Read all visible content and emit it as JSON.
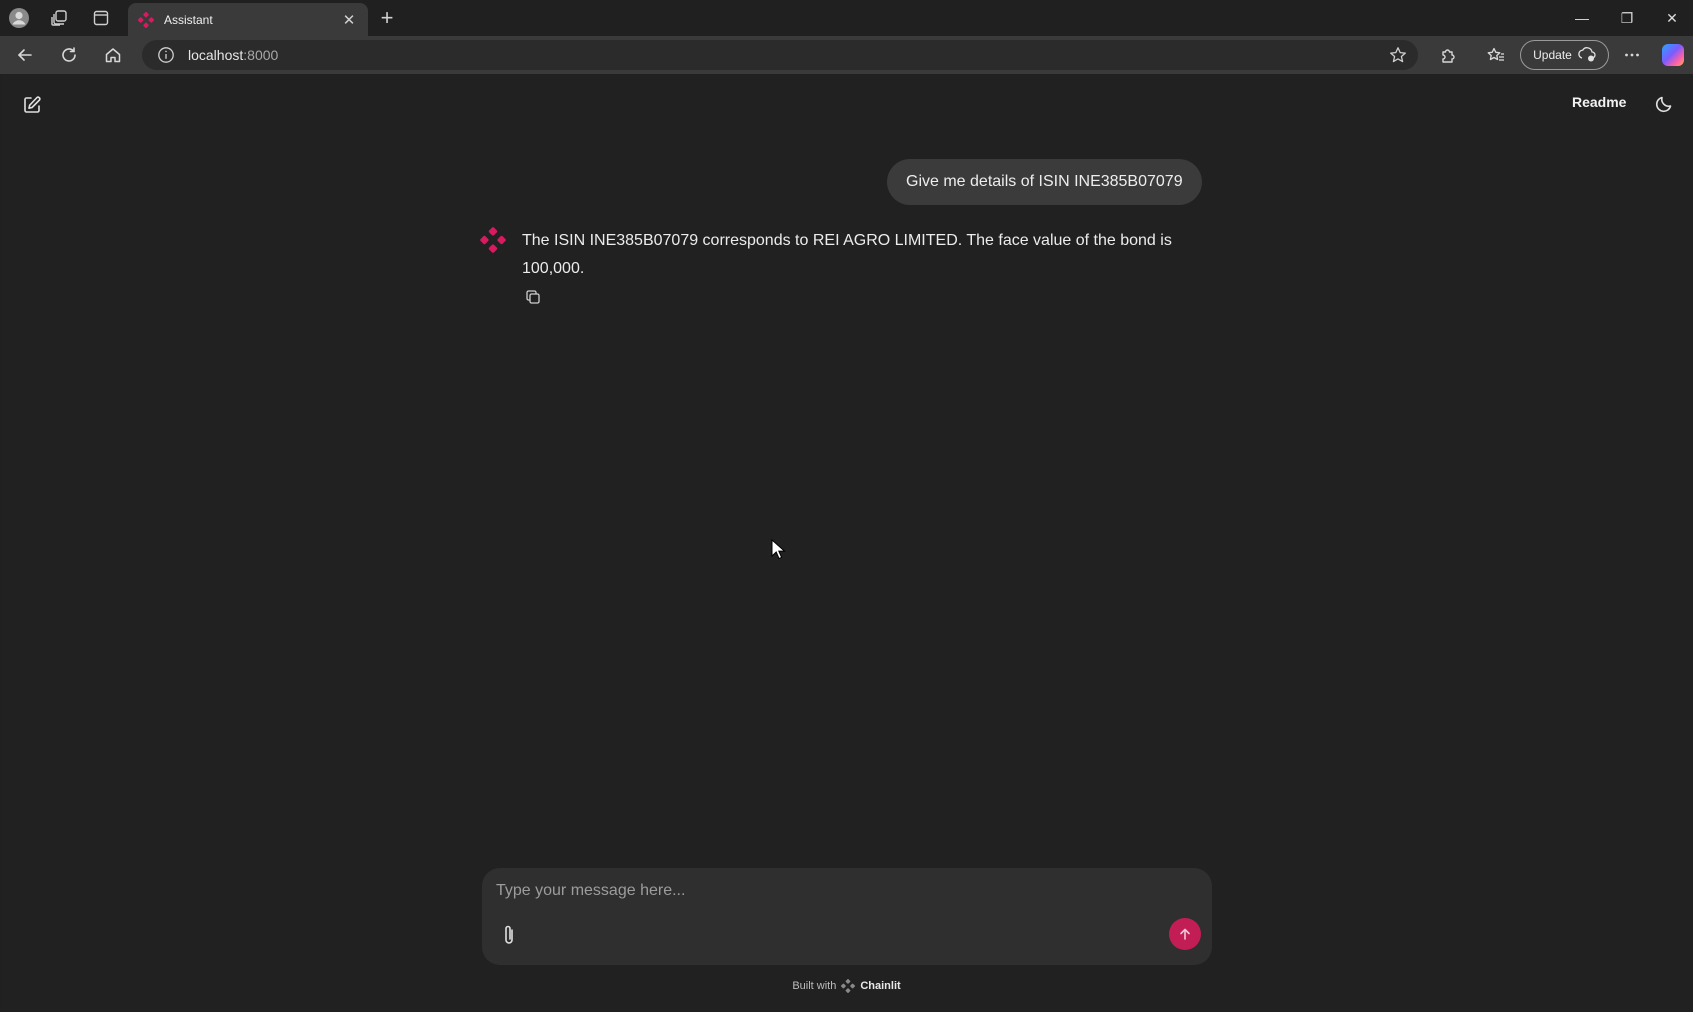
{
  "browser": {
    "tab": {
      "title": "Assistant",
      "close_label": "✕"
    },
    "new_tab_label": "+",
    "window_controls": {
      "minimize": "—",
      "restore": "❐",
      "close": "✕"
    },
    "address": {
      "host": "localhost",
      "port": ":8000"
    },
    "update_label": "Update"
  },
  "app": {
    "header": {
      "readme_label": "Readme"
    },
    "messages": {
      "user": "Give me details of ISIN INE385B07079",
      "assistant": "The ISIN INE385B07079 corresponds to REI AGRO LIMITED. The face value of the bond is 100,000."
    },
    "composer": {
      "placeholder": "Type your message here..."
    },
    "footer": {
      "built_with": "Built with",
      "brand": "Chainlit"
    }
  },
  "colors": {
    "accent": "#c31d55",
    "background": "#212121",
    "user_bubble": "#3b3b3b",
    "composer": "#2f2f2f"
  },
  "icons": {
    "profile": "profile-icon",
    "workspaces": "workspaces-icon",
    "tab_actions": "tab-actions-icon",
    "favicon": "chainlit-logo-icon",
    "back": "back-arrow-icon",
    "refresh": "refresh-icon",
    "home": "home-icon",
    "site_info": "info-icon",
    "favorite": "star-icon",
    "extensions": "extensions-icon",
    "favorites": "favorites-icon",
    "more": "more-icon",
    "copilot": "copilot-icon",
    "new_chat": "edit-icon",
    "theme": "moon-icon",
    "copy": "copy-icon",
    "attach": "paperclip-icon",
    "send": "arrow-up-icon"
  }
}
